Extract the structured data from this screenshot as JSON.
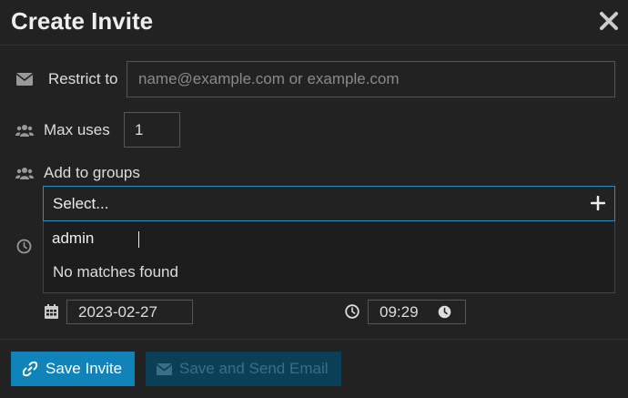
{
  "dialog": {
    "title": "Create Invite",
    "close_icon": "close-icon"
  },
  "restrict": {
    "label": "Restrict to",
    "placeholder": "name@example.com or example.com",
    "value": "",
    "icon": "envelope-icon"
  },
  "max_uses": {
    "label": "Max uses",
    "value": "1",
    "icon": "users-icon"
  },
  "groups": {
    "label": "Add to groups",
    "select_placeholder": "Select...",
    "search_value": "admin",
    "no_matches": "No matches found",
    "icon": "users-icon",
    "add_icon": "plus-icon"
  },
  "expires": {
    "icon": "clock-icon",
    "date": "2023-02-27",
    "time": "09:29 ",
    "date_icon": "calendar-icon",
    "time_icon": "clock-icon"
  },
  "footer": {
    "save_label": "Save Invite",
    "save_icon": "link-icon",
    "send_label": "Save and Send Email",
    "send_icon": "envelope-icon"
  },
  "colors": {
    "background": "#222222",
    "primary": "#0f83ba",
    "primary_disabled": "#0b3f57",
    "focus_border": "#2a8fbd"
  }
}
